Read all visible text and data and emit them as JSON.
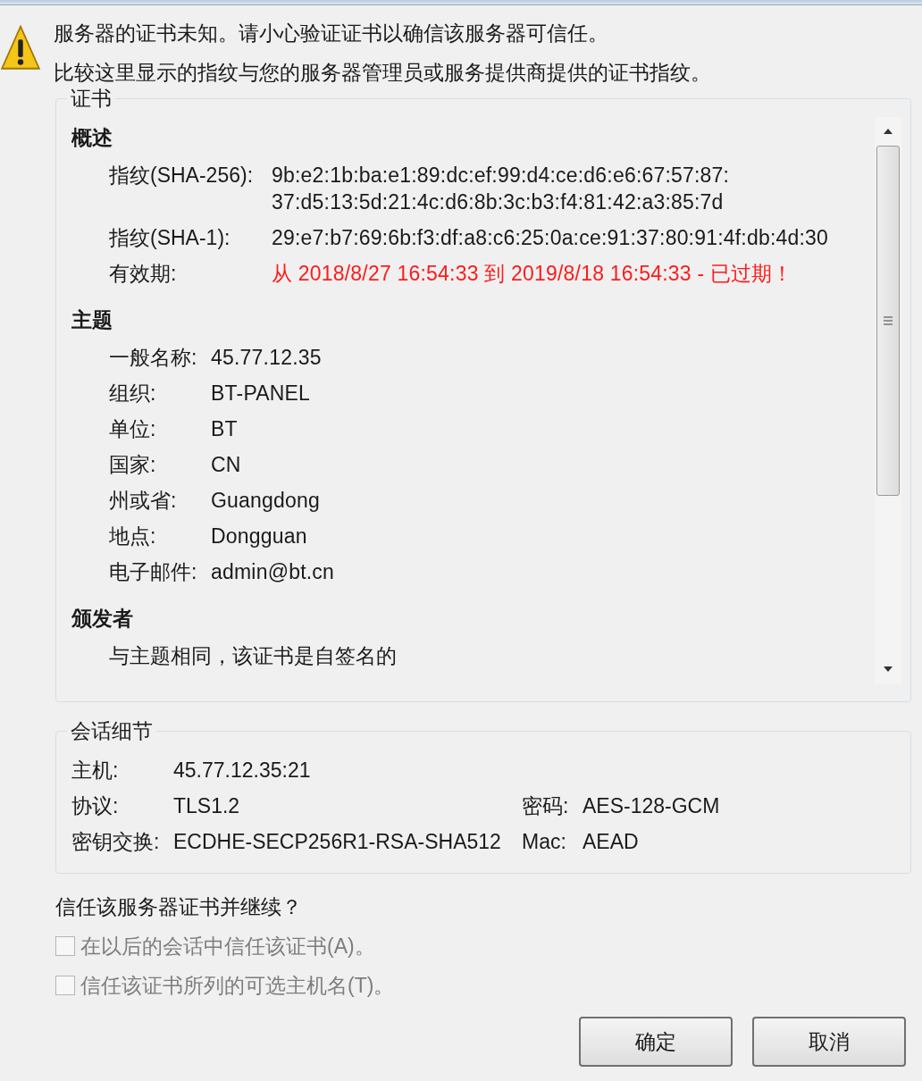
{
  "warning": {
    "lines": [
      "服务器的证书未知。请小心验证证书以确信该服务器可信任。",
      "比较这里显示的指纹与您的服务器管理员或服务提供商提供的证书指纹。"
    ]
  },
  "certificate": {
    "title": "证书",
    "sections": [
      {
        "heading": "概述",
        "kind": "wide",
        "rows": [
          {
            "label": "指纹(SHA-256):",
            "value": [
              "9b:e2:1b:ba:e1:89:dc:ef:99:d4:ce:d6:e6:67:57:87:",
              "37:d5:13:5d:21:4c:d6:8b:3c:b3:f4:81:42:a3:85:7d"
            ],
            "expired": false
          },
          {
            "label": "指纹(SHA-1):",
            "value": [
              "29:e7:b7:69:6b:f3:df:a8:c6:25:0a:ce:91:37:80:91:4f:db:4d:30"
            ],
            "expired": false
          },
          {
            "label": "有效期:",
            "value": [
              "从 2018/8/27 16:54:33 到 2019/8/18 16:54:33 - 已过期！"
            ],
            "expired": true
          }
        ]
      },
      {
        "heading": "主题",
        "kind": "narrow",
        "rows": [
          {
            "label": "一般名称:",
            "value": [
              "45.77.12.35"
            ],
            "expired": false
          },
          {
            "label": "组织:",
            "value": [
              "BT-PANEL"
            ],
            "expired": false
          },
          {
            "label": "单位:",
            "value": [
              "BT"
            ],
            "expired": false
          },
          {
            "label": "国家:",
            "value": [
              "CN"
            ],
            "expired": false
          },
          {
            "label": "州或省:",
            "value": [
              "Guangdong"
            ],
            "expired": false
          },
          {
            "label": "地点:",
            "value": [
              "Dongguan"
            ],
            "expired": false
          },
          {
            "label": "电子邮件:",
            "value": [
              "admin@bt.cn"
            ],
            "expired": false
          }
        ]
      },
      {
        "heading": "颁发者",
        "kind": "note",
        "text": "与主题相同，该证书是自签名的"
      }
    ]
  },
  "session": {
    "title": "会话细节",
    "rows": [
      [
        {
          "label": "主机:",
          "value": "45.77.12.35:21"
        }
      ],
      [
        {
          "label": "协议:",
          "value": "TLS1.2"
        },
        {
          "label": "密码:",
          "value": "AES-128-GCM"
        }
      ],
      [
        {
          "label": "密钥交换:",
          "value": "ECDHE-SECP256R1-RSA-SHA512"
        },
        {
          "label": "Mac:",
          "value": "AEAD"
        }
      ]
    ]
  },
  "question": "信任该服务器证书并继续？",
  "checkboxes": [
    {
      "label": "在以后的会话中信任该证书(A)。",
      "checked": false,
      "disabled": true
    },
    {
      "label": "信任该证书所列的可选主机名(T)。",
      "checked": false,
      "disabled": true
    }
  ],
  "buttons": [
    "确定",
    "取消"
  ]
}
